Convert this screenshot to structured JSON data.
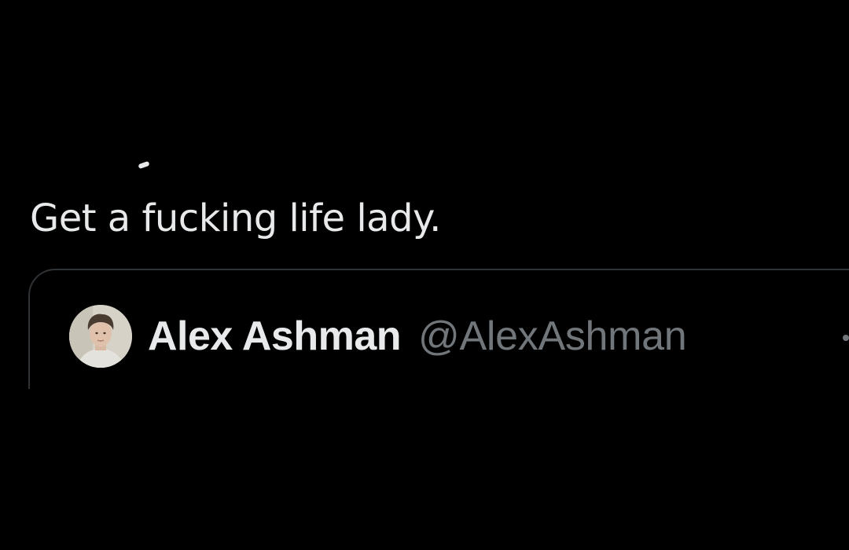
{
  "tweet": {
    "text": "Get a fucking life lady."
  },
  "quoted_tweet": {
    "author_name": "Alex Ashman",
    "author_handle": "@AlexAshman",
    "avatar": "profile-photo"
  },
  "colors": {
    "background": "#000000",
    "primary_text": "#e7e9ea",
    "secondary_text": "#71767b",
    "border": "#2f3336"
  }
}
